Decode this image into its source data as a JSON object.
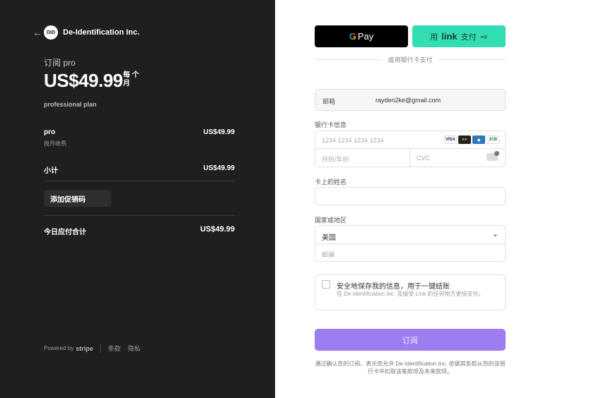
{
  "merchant": {
    "name": "De-Identification Inc.",
    "logo_text": "DID"
  },
  "summary": {
    "subscribe_label": "订阅 pro",
    "price": "US$49.99",
    "per_period": "每 个月",
    "plan_description": "professional plan",
    "line_item": {
      "name": "pro",
      "sub": "按月收费",
      "amount": "US$49.99"
    },
    "subtotal": {
      "label": "小计",
      "amount": "US$49.99"
    },
    "promo_label": "添加促销码",
    "total": {
      "label": "今日应付合计",
      "amount": "US$49.99"
    }
  },
  "footer": {
    "powered_by": "Powered by",
    "stripe": "stripe",
    "terms": "条款",
    "privacy": "隐私"
  },
  "wallets": {
    "gpay_label": "Pay",
    "gpay_g": "G",
    "link_prefix": "用",
    "link_brand": "link",
    "link_suffix": "支付",
    "link_arrow": "⇨"
  },
  "or_card": "或用银行卡支付",
  "email": {
    "label": "邮箱",
    "value": "rayden2ke@gmail.com"
  },
  "card": {
    "label": "银行卡信息",
    "number_placeholder": "1234 1234 1234 1234",
    "expiry_placeholder": "月份/年份",
    "cvc_placeholder": "CVC",
    "brands": [
      "VISA",
      "MC",
      "AMEX",
      "JCB"
    ]
  },
  "name_on_card": {
    "label": "卡上的姓名",
    "value": ""
  },
  "region": {
    "label": "国家或地区",
    "country": "美国",
    "postal_placeholder": "邮编"
  },
  "save_info": {
    "title": "安全地保存我的信息，用于一键结账",
    "description": "在 De-Identification Inc. 及接受 Link 的任何地方更快支付。",
    "checked": false
  },
  "submit_label": "订阅",
  "terms_text": "通过确认您的订阅，表示您允许 De-Identification Inc. 依据其条款从您的该银行卡中扣取该笔款项及未来款项。"
}
